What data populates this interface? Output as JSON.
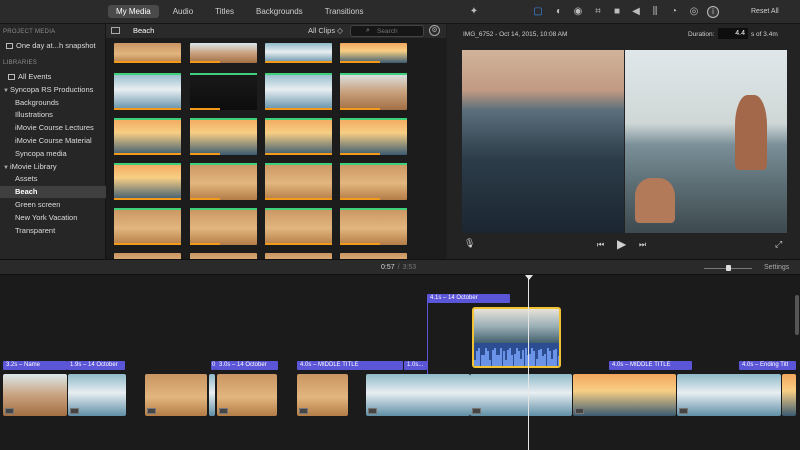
{
  "tabs": [
    "My Media",
    "Audio",
    "Titles",
    "Backgrounds",
    "Transitions"
  ],
  "active_tab": "My Media",
  "adjust_toolbar": {
    "icons": [
      "magic-wand-icon",
      "color-balance-icon",
      "color-correction-icon",
      "filter-icon",
      "crop-icon",
      "camera-icon",
      "volume-icon",
      "equalizer-icon",
      "speed-icon",
      "noise-reduction-icon",
      "info-icon"
    ],
    "reset_label": "Reset All"
  },
  "sidebar": {
    "project_media_heading": "PROJECT MEDIA",
    "project_item": "One day at...h snapshot",
    "libraries_heading": "LIBRARIES",
    "rows": [
      {
        "label": "All Events",
        "indent": 0,
        "icon": true
      },
      {
        "label": "Syncopa RS Productions",
        "indent": 0,
        "tri": "▼"
      },
      {
        "label": "Backgrounds",
        "indent": 1
      },
      {
        "label": "Illustrations",
        "indent": 1
      },
      {
        "label": "iMovie Course Lectures",
        "indent": 1
      },
      {
        "label": "iMovie Course Material",
        "indent": 1
      },
      {
        "label": "Syncopa media",
        "indent": 1
      },
      {
        "label": "iMovie Library",
        "indent": 0,
        "tri": "▼"
      },
      {
        "label": "Assets",
        "indent": 1
      },
      {
        "label": "Beach",
        "indent": 1,
        "selected": true
      },
      {
        "label": "Green screen",
        "indent": 1
      },
      {
        "label": "New York Vacation",
        "indent": 1
      },
      {
        "label": "Transparent",
        "indent": 1
      }
    ]
  },
  "browser": {
    "library_name": "Beach",
    "filter_label": "All Clips ◇",
    "search_placeholder": "Search"
  },
  "viewer": {
    "clip_info": "IMG_6752 - Oct 14, 2015, 10:08 AM",
    "duration_label": "Duration:",
    "duration_value": "4.4",
    "duration_suffix": "s of 3.4m"
  },
  "timeline": {
    "current_time": "0:57",
    "separator": "/",
    "total_time": "3:53",
    "settings_label": "Settings",
    "zoom_fraction": 0.45,
    "titles": [
      {
        "label": "3.2s – Name"
      },
      {
        "label": "1.9s – 14 October"
      },
      {
        "label": "0"
      },
      {
        "label": "3.0s – 14 October"
      },
      {
        "label": "4.0s – MIDDLE TITLE"
      },
      {
        "label": "1.0s..."
      },
      {
        "label": "4.0s – MIDDLE TITLE"
      },
      {
        "label": "4.0s – Ending Titl"
      }
    ],
    "broll_title": "4.1s – 14 October"
  }
}
